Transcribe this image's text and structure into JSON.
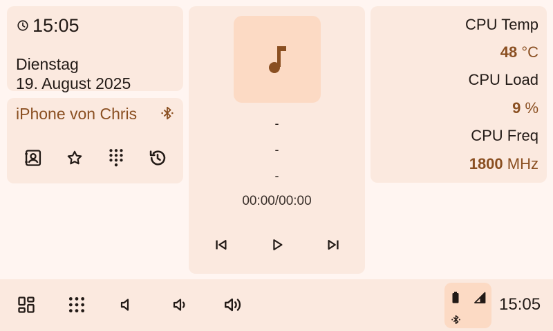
{
  "clock": {
    "time": "15:05",
    "weekday": "Dienstag",
    "date": "19. August 2025"
  },
  "phone": {
    "device_name": "iPhone von Chris",
    "actions": [
      {
        "name": "contacts",
        "icon": "contacts-icon"
      },
      {
        "name": "favorites",
        "icon": "star-icon"
      },
      {
        "name": "dialpad",
        "icon": "dialpad-icon"
      },
      {
        "name": "call-history",
        "icon": "history-icon"
      }
    ]
  },
  "media": {
    "title": "-",
    "artist": "-",
    "album": "-",
    "time": "00:00/00:00",
    "icons": [
      "music-note-icon",
      "skip-previous-icon",
      "play-icon",
      "skip-next-icon"
    ]
  },
  "system": {
    "cpu_temp_label": "CPU Temp",
    "cpu_temp_value": "48",
    "cpu_temp_unit": "°C",
    "cpu_load_label": "CPU Load",
    "cpu_load_value": "9",
    "cpu_load_unit": "%",
    "cpu_freq_label": "CPU Freq",
    "cpu_freq_value": "1800",
    "cpu_freq_unit": "MHz"
  },
  "taskbar": {
    "clock": "15:05",
    "icons": [
      "dashboard-icon",
      "app-grid-icon",
      "volume-mute-icon",
      "volume-down-icon",
      "volume-up-icon"
    ],
    "tray_icons": [
      "battery-icon",
      "signal-icon",
      "bluetooth-icon"
    ]
  },
  "colors": {
    "background": "#fff5f1",
    "card": "#fbe9df",
    "accent": "#8a4f21",
    "highlight": "#fcdac4",
    "text": "#221a16"
  }
}
